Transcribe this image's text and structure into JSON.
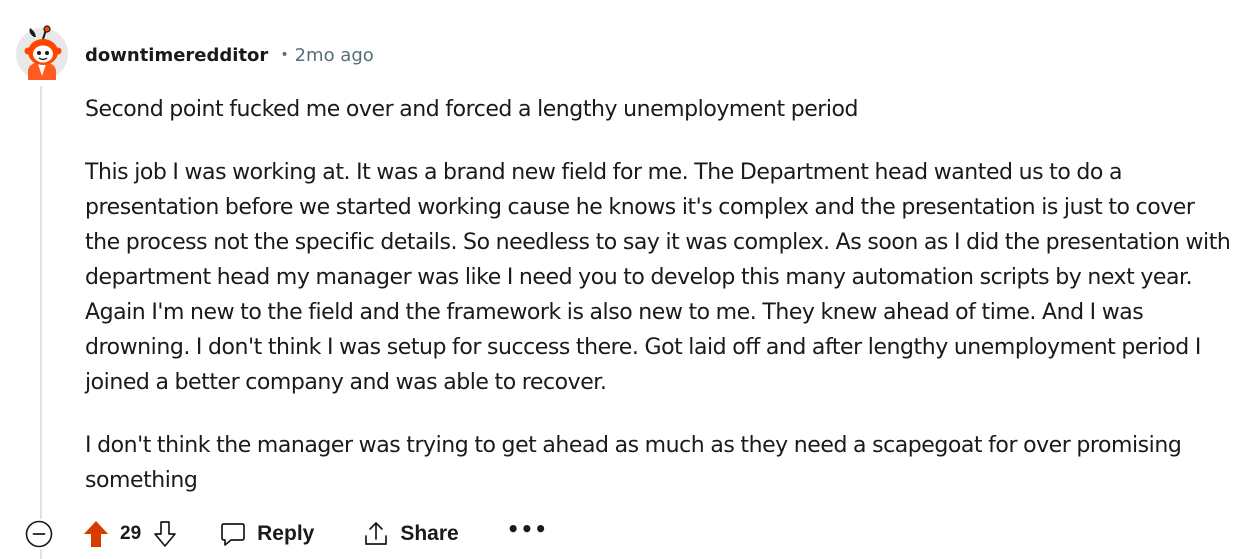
{
  "comment": {
    "author": "downtimeredditor",
    "separator": "•",
    "time": "2mo ago",
    "paragraphs": [
      "Second point fucked me over and forced a lengthy unemployment period",
      "This job I was working at. It was a brand new field for me. The Department head wanted us to do a presentation before we started working cause he knows it's complex and the presentation is just to cover the process not the specific details. So needless to say it was complex. As soon as I did the presentation with department head my manager was like I need you to develop this many automation scripts by next year. Again I'm new to the field and the framework is also new to me. They knew ahead of time. And I was drowning. I don't think I was setup for success there. Got laid off and after lengthy unemployment period I joined a better company and was able to recover.",
      "I don't think the manager was trying to get ahead as much as they need a scapegoat for over promising something"
    ]
  },
  "actions": {
    "score": "29",
    "upvoted": true,
    "reply_label": "Reply",
    "share_label": "Share",
    "more_label": "•••"
  },
  "icons": {
    "avatar": "snoo-avatar-icon",
    "collapse": "collapse-minus-icon",
    "upvote": "upvote-arrow-icon",
    "downvote": "downvote-arrow-icon",
    "reply": "reply-bubble-icon",
    "share": "share-icon",
    "more": "more-options-icon"
  },
  "colors": {
    "upvote_active": "#d93a00",
    "text": "#1a1a1b",
    "meta": "#576f76",
    "thread_line": "#e0e3e6",
    "avatar_bg": "#e8e8e8"
  }
}
